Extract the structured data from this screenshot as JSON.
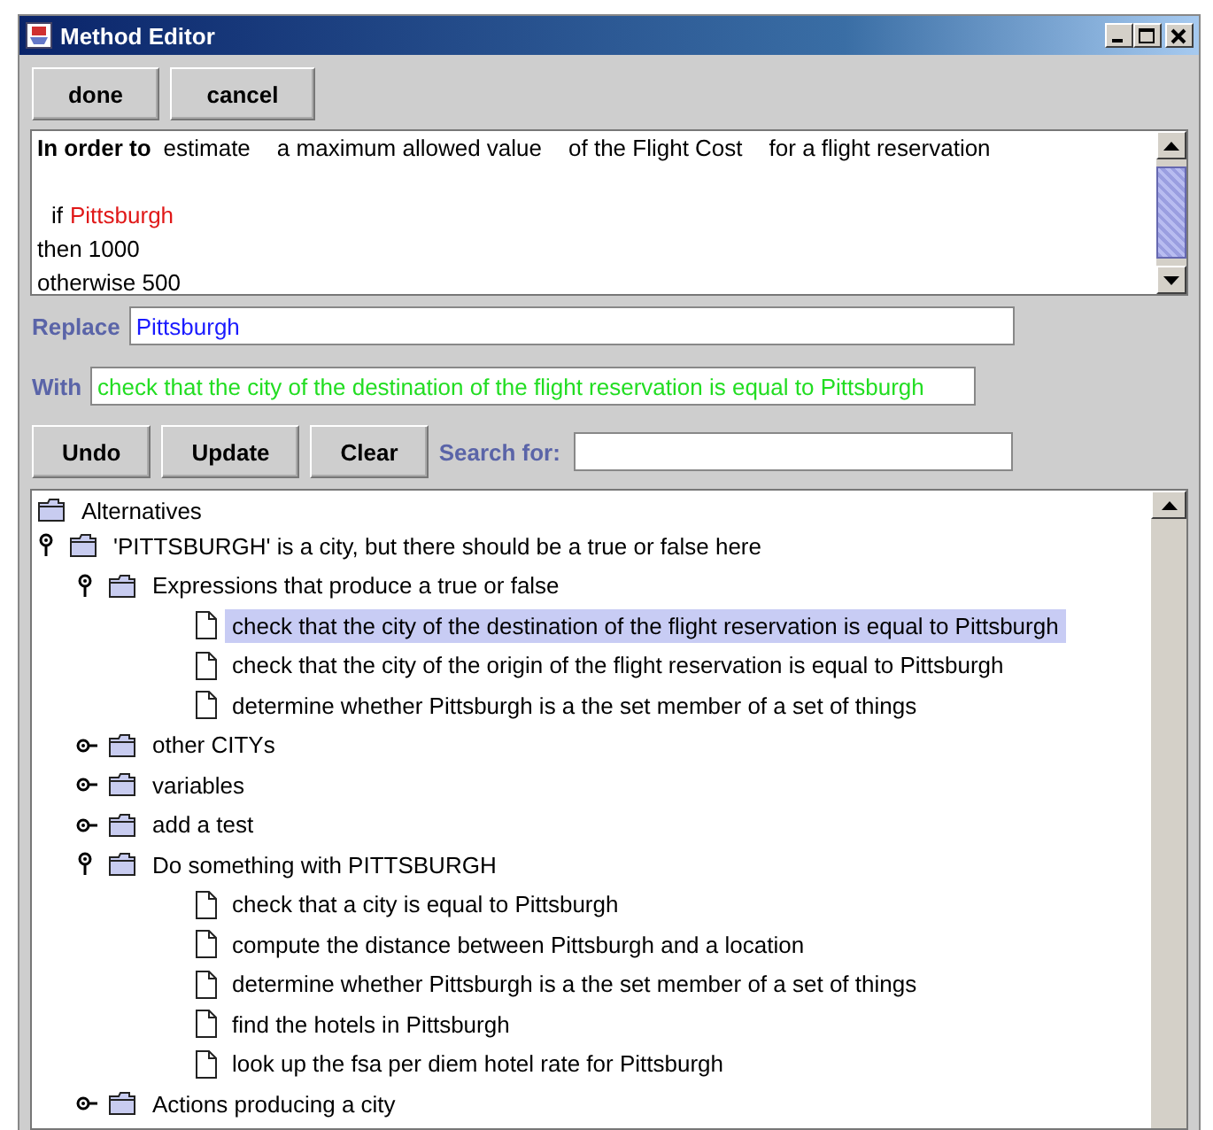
{
  "window": {
    "title": "Method Editor"
  },
  "toolbar": {
    "buttons": [
      "done",
      "cancel"
    ]
  },
  "editor": {
    "lines": [
      {
        "kind": "header",
        "segments": [
          {
            "kind": "keyword",
            "text": "In order to"
          },
          {
            "kind": "phrase",
            "text": "estimate"
          },
          {
            "kind": "phrase",
            "text": "a maximum allowed value"
          },
          {
            "kind": "phrase",
            "text": "of the Flight Cost"
          },
          {
            "kind": "phrase",
            "text": "for a flight reservation"
          }
        ]
      },
      {
        "kind": "condition",
        "segments": [
          {
            "kind": "plain",
            "text": "if"
          },
          {
            "kind": "placeholder",
            "text": "Pittsburgh"
          }
        ]
      },
      {
        "kind": "plain",
        "segments": [
          {
            "kind": "plain",
            "text": "then 1000"
          }
        ]
      },
      {
        "kind": "plain",
        "segments": [
          {
            "kind": "plain",
            "text": "otherwise 500"
          }
        ]
      }
    ]
  },
  "replace": {
    "label": "Replace",
    "value": "Pittsburgh"
  },
  "with": {
    "label": "With",
    "value": "check that the city of the destination of the flight reservation is equal to Pittsburgh"
  },
  "actions": {
    "buttons": [
      "Undo",
      "Update",
      "Clear"
    ],
    "search_label": "Search for:"
  },
  "tree": {
    "kind": "root",
    "label": "Alternatives",
    "children": [
      {
        "kind": "folder",
        "label": "'PITTSBURGH' is a city, but there should be a true or false here",
        "expanded": true,
        "children": [
          {
            "kind": "folder",
            "label": "Expressions that produce a true or false",
            "expanded": true,
            "children": [
              {
                "kind": "document",
                "label": "check that the city of the destination of the flight reservation is equal to Pittsburgh",
                "selected": true
              },
              {
                "kind": "document",
                "label": "check that the city of the origin of the flight reservation is equal to Pittsburgh",
                "selected": false
              },
              {
                "kind": "document",
                "label": "determine whether Pittsburgh is a the set member of a set of things",
                "selected": false
              }
            ]
          },
          {
            "kind": "folder",
            "label": "other CITYs",
            "expanded": false
          },
          {
            "kind": "folder",
            "label": "variables",
            "expanded": false
          },
          {
            "kind": "folder",
            "label": "add a test",
            "expanded": false
          },
          {
            "kind": "folder",
            "label": "Do something with PITTSBURGH",
            "expanded": true,
            "children": [
              {
                "kind": "document",
                "label": "check that a city is equal to Pittsburgh",
                "selected": false
              },
              {
                "kind": "document",
                "label": "compute the distance between Pittsburgh and a location",
                "selected": false
              },
              {
                "kind": "document",
                "label": "determine whether Pittsburgh is a the set member of a set of things",
                "selected": false
              },
              {
                "kind": "document",
                "label": "find the hotels in Pittsburgh",
                "selected": false
              },
              {
                "kind": "document",
                "label": "look up the fsa per diem hotel rate for Pittsburgh",
                "selected": false
              }
            ]
          },
          {
            "kind": "folder",
            "label": "Actions producing a city",
            "expanded": false
          }
        ]
      }
    ]
  }
}
